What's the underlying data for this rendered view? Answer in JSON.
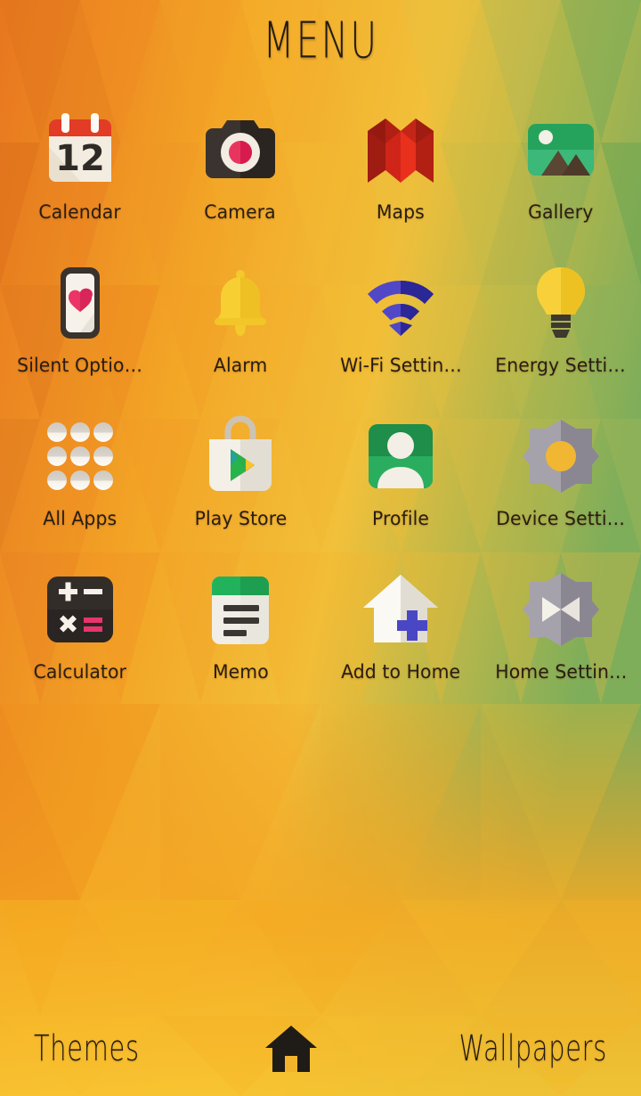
{
  "header": {
    "title": "MENU"
  },
  "theme": {
    "label_color": "#2a1d12",
    "bg_orange": "#ef8b22",
    "bg_amber": "#f5a623",
    "bg_yellow": "#f6c232",
    "bg_green": "#6aa84f",
    "accent_red": "#d32f1e",
    "accent_green": "#21a558",
    "accent_blue": "#3f3fbf",
    "accent_pink": "#e8305f",
    "accent_grey": "#8e8b93"
  },
  "grid": {
    "columns": 4,
    "rows": 4,
    "apps": [
      {
        "label": "Calendar",
        "icon": "calendar-icon",
        "day": "12"
      },
      {
        "label": "Camera",
        "icon": "camera-icon"
      },
      {
        "label": "Maps",
        "icon": "maps-icon"
      },
      {
        "label": "Gallery",
        "icon": "gallery-icon"
      },
      {
        "label": "Silent Optio…",
        "icon": "silent-options-icon"
      },
      {
        "label": "Alarm",
        "icon": "alarm-bell-icon"
      },
      {
        "label": "Wi-Fi Settin…",
        "icon": "wifi-icon"
      },
      {
        "label": "Energy Setti…",
        "icon": "lightbulb-icon"
      },
      {
        "label": "All Apps",
        "icon": "all-apps-grid-icon"
      },
      {
        "label": "Play Store",
        "icon": "play-store-icon"
      },
      {
        "label": "Profile",
        "icon": "profile-icon"
      },
      {
        "label": "Device Setti…",
        "icon": "gear-icon"
      },
      {
        "label": "Calculator",
        "icon": "calculator-icon"
      },
      {
        "label": "Memo",
        "icon": "memo-icon"
      },
      {
        "label": "Add to Home",
        "icon": "add-to-home-icon"
      },
      {
        "label": "Home Settin…",
        "icon": "home-settings-gear-icon"
      }
    ]
  },
  "dock": {
    "themes_label": "Themes",
    "home_icon": "home-icon",
    "wallpapers_label": "Wallpapers"
  }
}
